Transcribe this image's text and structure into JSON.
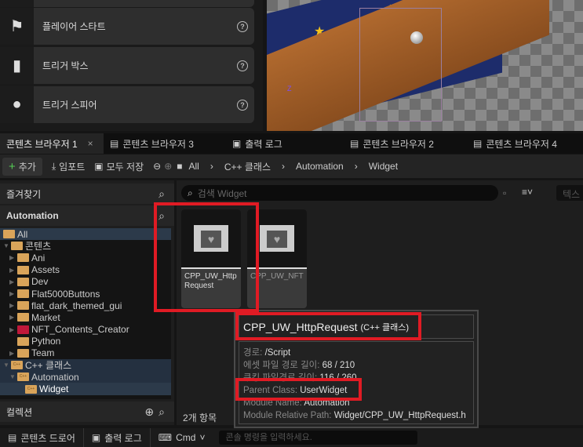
{
  "place_actors": [
    {
      "label": "플레이어 스타트",
      "icon": "player-start-icon"
    },
    {
      "label": "트리거 박스",
      "icon": "trigger-box-icon"
    },
    {
      "label": "트리거 스피어",
      "icon": "trigger-sphere-icon"
    }
  ],
  "tabs": [
    {
      "label": "콘텐츠 브라우저 1",
      "close": "×"
    },
    {
      "label": "콘텐츠 브라우저 3"
    },
    {
      "label": "출력 로그"
    },
    {
      "label": "콘텐츠 브라우저 2"
    },
    {
      "label": "콘텐츠 브라우저 4"
    }
  ],
  "toolbar": {
    "add": "추가",
    "import": "임포트",
    "save_all": "모두 저장",
    "breadcrumb": [
      "All",
      "C++ 클래스",
      "Automation",
      "Widget"
    ]
  },
  "left": {
    "favorites": "즐겨찾기",
    "project": "Automation",
    "collections": "컬렉션",
    "tree": [
      {
        "label": "All"
      },
      {
        "label": "콘텐츠"
      },
      {
        "label": "Ani"
      },
      {
        "label": "Assets"
      },
      {
        "label": "Dev"
      },
      {
        "label": "Flat5000Buttons"
      },
      {
        "label": "flat_dark_themed_gui"
      },
      {
        "label": "Market"
      },
      {
        "label": "NFT_Contents_Creator"
      },
      {
        "label": "Python"
      },
      {
        "label": "Team"
      },
      {
        "label": "C++ 클래스"
      },
      {
        "label": "Automation"
      },
      {
        "label": "Widget"
      }
    ]
  },
  "search": {
    "placeholder": "검색 Widget",
    "right_field": "텍스"
  },
  "assets": [
    {
      "name": "CPP_UW_HttpRequest"
    },
    {
      "name": "CPP_UW_NFT"
    }
  ],
  "status": "2개 항목",
  "tooltip": {
    "title": "CPP_UW_HttpRequest",
    "type": "(C++ 클래스)",
    "rows": [
      {
        "k": "경로: ",
        "v": "/Script"
      },
      {
        "k": "에셋 파일 경로 길이: ",
        "v": "68 / 210"
      },
      {
        "k": "쿠킹 파일경로 길이: ",
        "v": "116 / 260"
      },
      {
        "k": "Parent Class: ",
        "v": "UserWidget"
      },
      {
        "k": "Module Name: ",
        "v": "Automation"
      },
      {
        "k": "Module Relative Path: ",
        "v": "Widget/CPP_UW_HttpRequest.h"
      }
    ]
  },
  "bottom": {
    "drawer": "콘텐츠 드로어",
    "output": "출력 로그",
    "cmd": "Cmd",
    "console_placeholder": "콘솔 명령을 입력하세요."
  },
  "colors": {
    "highlight": "#e01b24",
    "folder": "#d9a45a",
    "selection": "#2c3a4a"
  }
}
